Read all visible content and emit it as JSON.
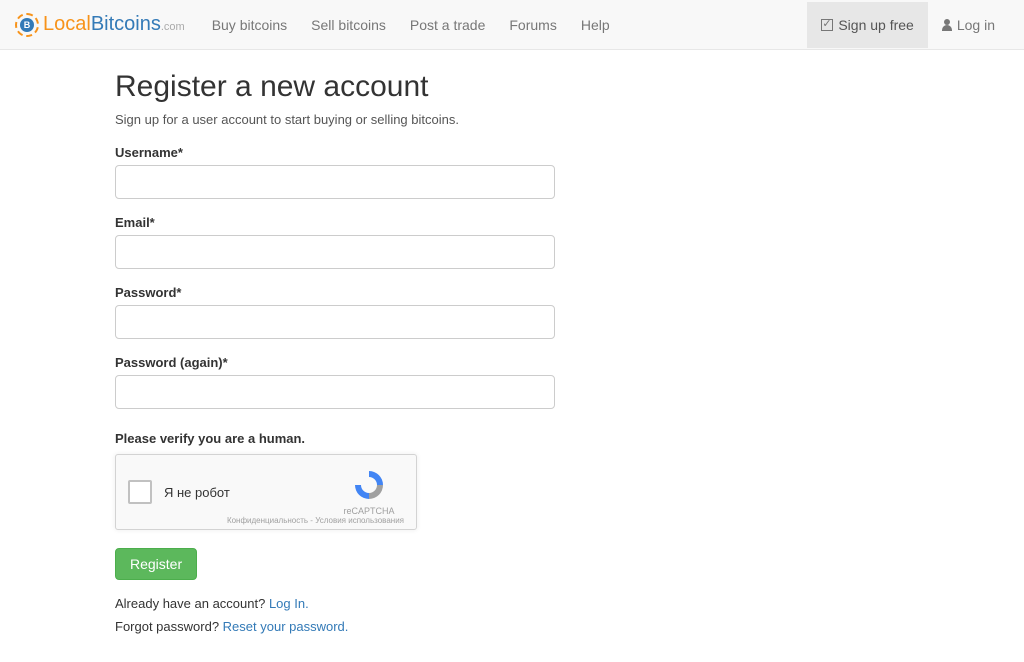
{
  "brand": {
    "local": "Local",
    "bitcoins": "Bitcoins",
    "com": ".com",
    "icon_letter": "B"
  },
  "nav": {
    "buy": "Buy bitcoins",
    "sell": "Sell bitcoins",
    "post": "Post a trade",
    "forums": "Forums",
    "help": "Help"
  },
  "navRight": {
    "signup": "Sign up free",
    "login": "Log in"
  },
  "page": {
    "heading": "Register a new account",
    "subtitle": "Sign up for a user account to start buying or selling bitcoins."
  },
  "form": {
    "username_label": "Username*",
    "username_value": "",
    "email_label": "Email*",
    "email_value": "",
    "password_label": "Password*",
    "password_value": "",
    "password2_label": "Password (again)*",
    "password2_value": "",
    "captcha_label": "Please verify you are a human.",
    "register_button": "Register"
  },
  "recaptcha": {
    "text": "Я не робот",
    "brand": "reCAPTCHA",
    "footer": "Конфиденциальность - Условия использования"
  },
  "helpers": {
    "already_text": "Already have an account? ",
    "login_link": "Log In.",
    "forgot_text": "Forgot password? ",
    "reset_link": "Reset your password."
  }
}
